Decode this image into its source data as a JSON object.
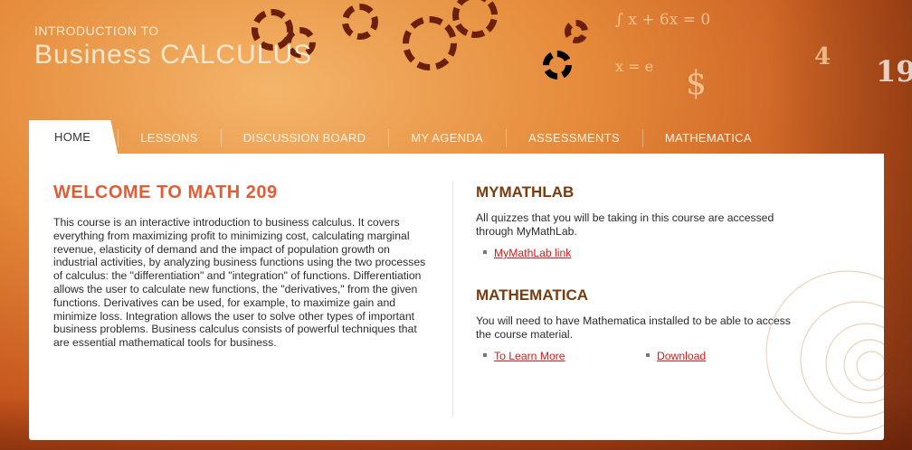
{
  "site": {
    "title_small": "INTRODUCTION TO",
    "title_big": "Business CALCULUS"
  },
  "tabs": [
    {
      "label": "HOME"
    },
    {
      "label": "LESSONS"
    },
    {
      "label": "DISCUSSION BOARD"
    },
    {
      "label": "MY AGENDA"
    },
    {
      "label": "ASSESSMENTS"
    },
    {
      "label": "MATHEMATICA"
    }
  ],
  "welcome": {
    "heading": "WELCOME TO MATH 209",
    "body": "This course is an interactive introduction to business calculus. It covers everything from maximizing profit to minimizing cost, calculating marginal revenue, elasticity of demand and the impact of population growth on industrial activities, by analyzing business functions using the two processes of calculus: the \"differentiation\" and \"integration\" of functions. Differentiation allows the user to calculate new functions, the \"derivatives,\" from the given functions. Derivatives can be used, for example, to maximize gain and minimize loss. Integration allows the user to solve other types of important business problems. Business calculus consists of powerful techniques that are essential mathematical tools for business."
  },
  "mymathlab": {
    "heading": "MYMATHLAB",
    "text": "All quizzes that you will be taking in this course are accessed through MyMathLab.",
    "link": "MyMathLab link"
  },
  "mathematica": {
    "heading": "MATHEMATICA",
    "text": "You will need to have Mathematica installed to be able to access the course material.",
    "link1": "To Learn More",
    "link2": "Download"
  },
  "colors": {
    "banner": "#e58a3a",
    "welcome_heading": "#e45c36",
    "section_heading": "#7a3b0d",
    "link": "#d41a1a"
  }
}
